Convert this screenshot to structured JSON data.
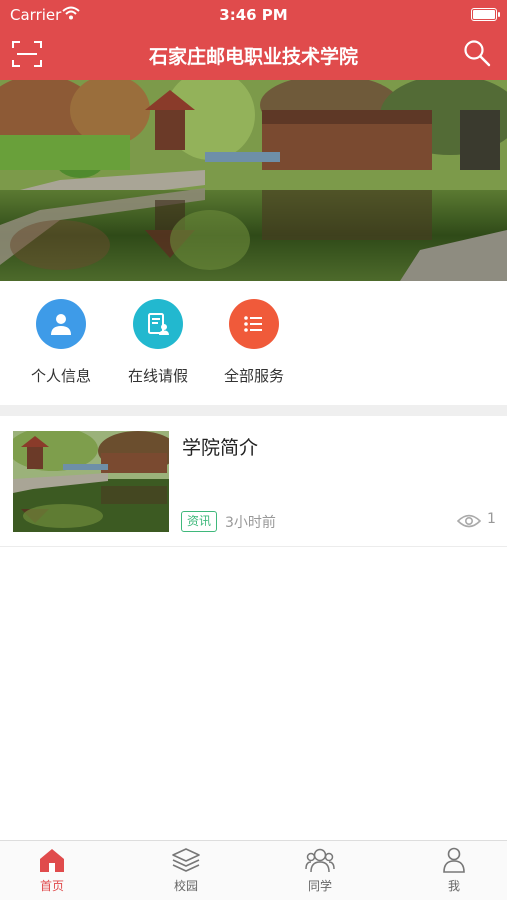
{
  "status_bar": {
    "carrier": "Carrier",
    "time": "3:46 PM"
  },
  "nav": {
    "title": "石家庄邮电职业技术学院",
    "left_icon": "scan-icon",
    "right_icon": "search-icon"
  },
  "quick_actions": [
    {
      "label": "个人信息",
      "icon": "person-icon",
      "color": "#3e9be8"
    },
    {
      "label": "在线请假",
      "icon": "leave-form-icon",
      "color": "#22b8cf"
    },
    {
      "label": "全部服务",
      "icon": "list-icon",
      "color": "#f05a3a"
    }
  ],
  "news": [
    {
      "title": "学院简介",
      "tag": "资讯",
      "time_ago": "3小时前",
      "views": "1"
    }
  ],
  "tabs": [
    {
      "label": "首页",
      "icon": "home-icon",
      "active": true
    },
    {
      "label": "校园",
      "icon": "layers-icon",
      "active": false
    },
    {
      "label": "同学",
      "icon": "classmates-icon",
      "active": false
    },
    {
      "label": "我",
      "icon": "user-icon",
      "active": false
    }
  ],
  "colors": {
    "brand": "#e04b4c",
    "tag_green": "#3fb87b"
  }
}
